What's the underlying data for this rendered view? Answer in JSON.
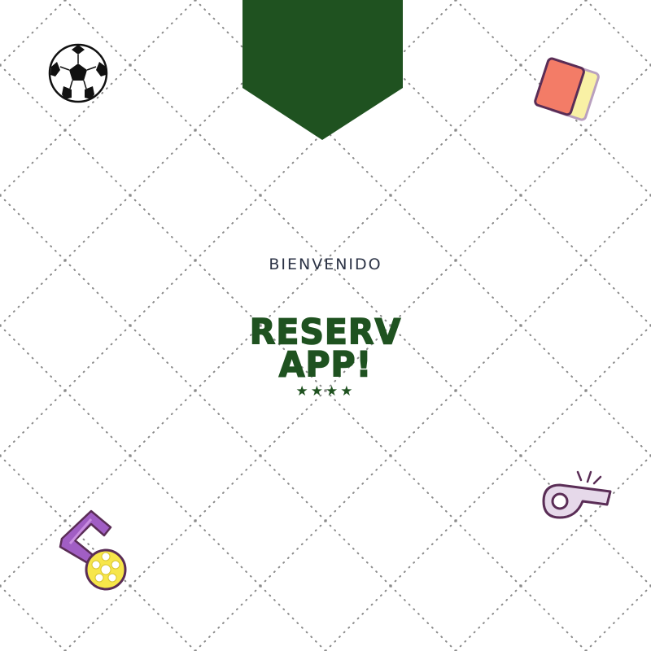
{
  "welcome_text": "BIENVENIDO",
  "brand": {
    "line1": "RESERV",
    "line2": "APP!",
    "stars": "★★★★"
  },
  "colors": {
    "brand_green": "#1f5220",
    "text_dark": "#2b3245",
    "dot_pattern": "#8a8a8a",
    "card_red": "#f37c67",
    "card_yellow": "#f9f1a5",
    "medal_ribbon": "#a15ec4",
    "medal_gold": "#f7e64a",
    "whistle": "#e6d9ea"
  },
  "icons": [
    "soccer-ball-icon",
    "referee-cards-icon",
    "medal-icon",
    "whistle-icon"
  ]
}
